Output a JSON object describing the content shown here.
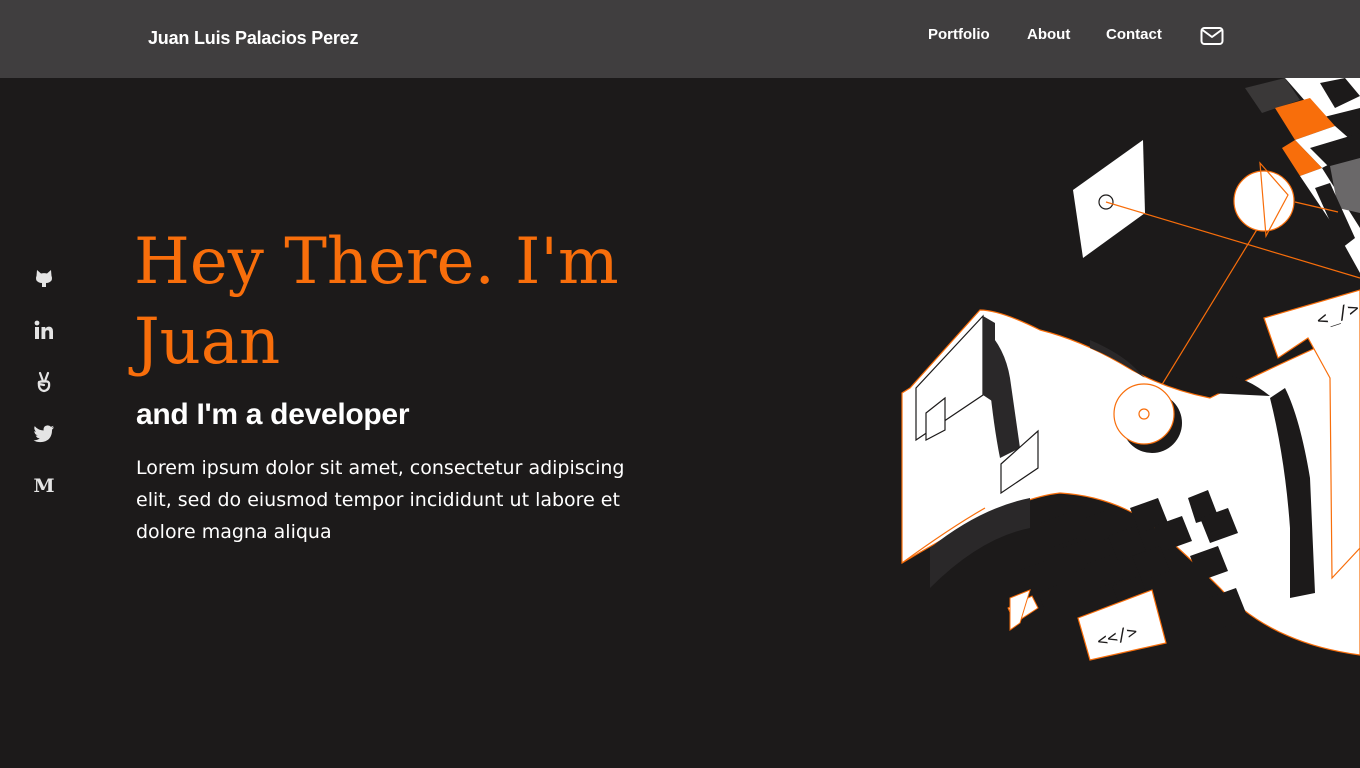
{
  "header": {
    "brand": "Juan Luis Palacios Perez",
    "nav": {
      "portfolio": "Portfolio",
      "about": "About",
      "contact": "Contact"
    },
    "mail_icon": "mail-icon"
  },
  "social": [
    {
      "name": "github",
      "icon": "github-icon"
    },
    {
      "name": "linkedin",
      "icon": "linkedin-icon"
    },
    {
      "name": "angellist",
      "icon": "angellist-icon"
    },
    {
      "name": "twitter",
      "icon": "twitter-icon"
    },
    {
      "name": "medium",
      "icon": "medium-icon",
      "glyph": "M"
    }
  ],
  "hero": {
    "title": "Hey There. I'm Juan",
    "subtitle": "and I'm a developer",
    "body": "Lorem ipsum dolor sit amet, consectetur adipiscing elit, sed do eiusmod tempor incididunt ut labore et dolore magna aliqua"
  },
  "illustration": {
    "code_tag_1": "<_/>",
    "code_tag_2": "<</>"
  },
  "colors": {
    "accent": "#f86e0b",
    "background": "#1c1a1a",
    "header": "#403e3f",
    "text": "#ffffff"
  }
}
